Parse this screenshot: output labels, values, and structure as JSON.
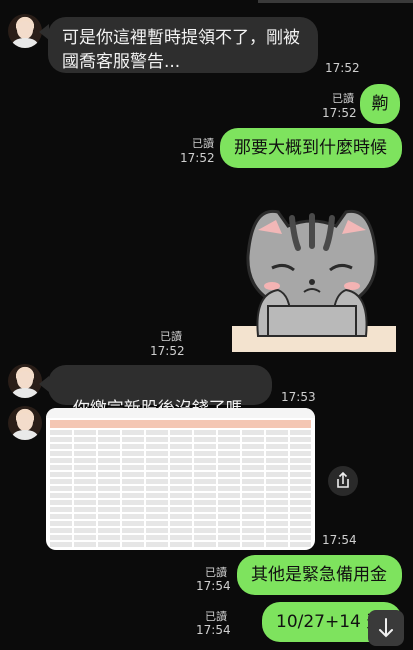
{
  "messages": {
    "m1": {
      "text": "可是你這裡暫時提領不了，剛被\n國喬客服警告...",
      "time": "17:52"
    },
    "m2": {
      "text": "齁",
      "read": "已讀",
      "time": "17:52"
    },
    "m3": {
      "text": "那要大概到什麼時候",
      "read": "已讀",
      "time": "17:52"
    },
    "m4": {
      "read": "已讀",
      "time": "17:52"
    },
    "m5": {
      "text": "你繳完新股後沒錢了嗎",
      "emoji": "😅",
      "time": "17:53"
    },
    "m6": {
      "time": "17:54"
    },
    "m7": {
      "text": "其他是緊急備用金",
      "read": "已讀",
      "time": "17:54"
    },
    "m8": {
      "text": "10/27+14 天",
      "read": "已讀",
      "time": "17:54"
    }
  },
  "icons": {
    "share": "share-icon",
    "scroll": "arrow-down-icon",
    "avatar": "avatar"
  },
  "colors": {
    "bg": "#0b0b0b",
    "incoming": "#2e2e2e",
    "outgoing": "#7ee35e"
  }
}
